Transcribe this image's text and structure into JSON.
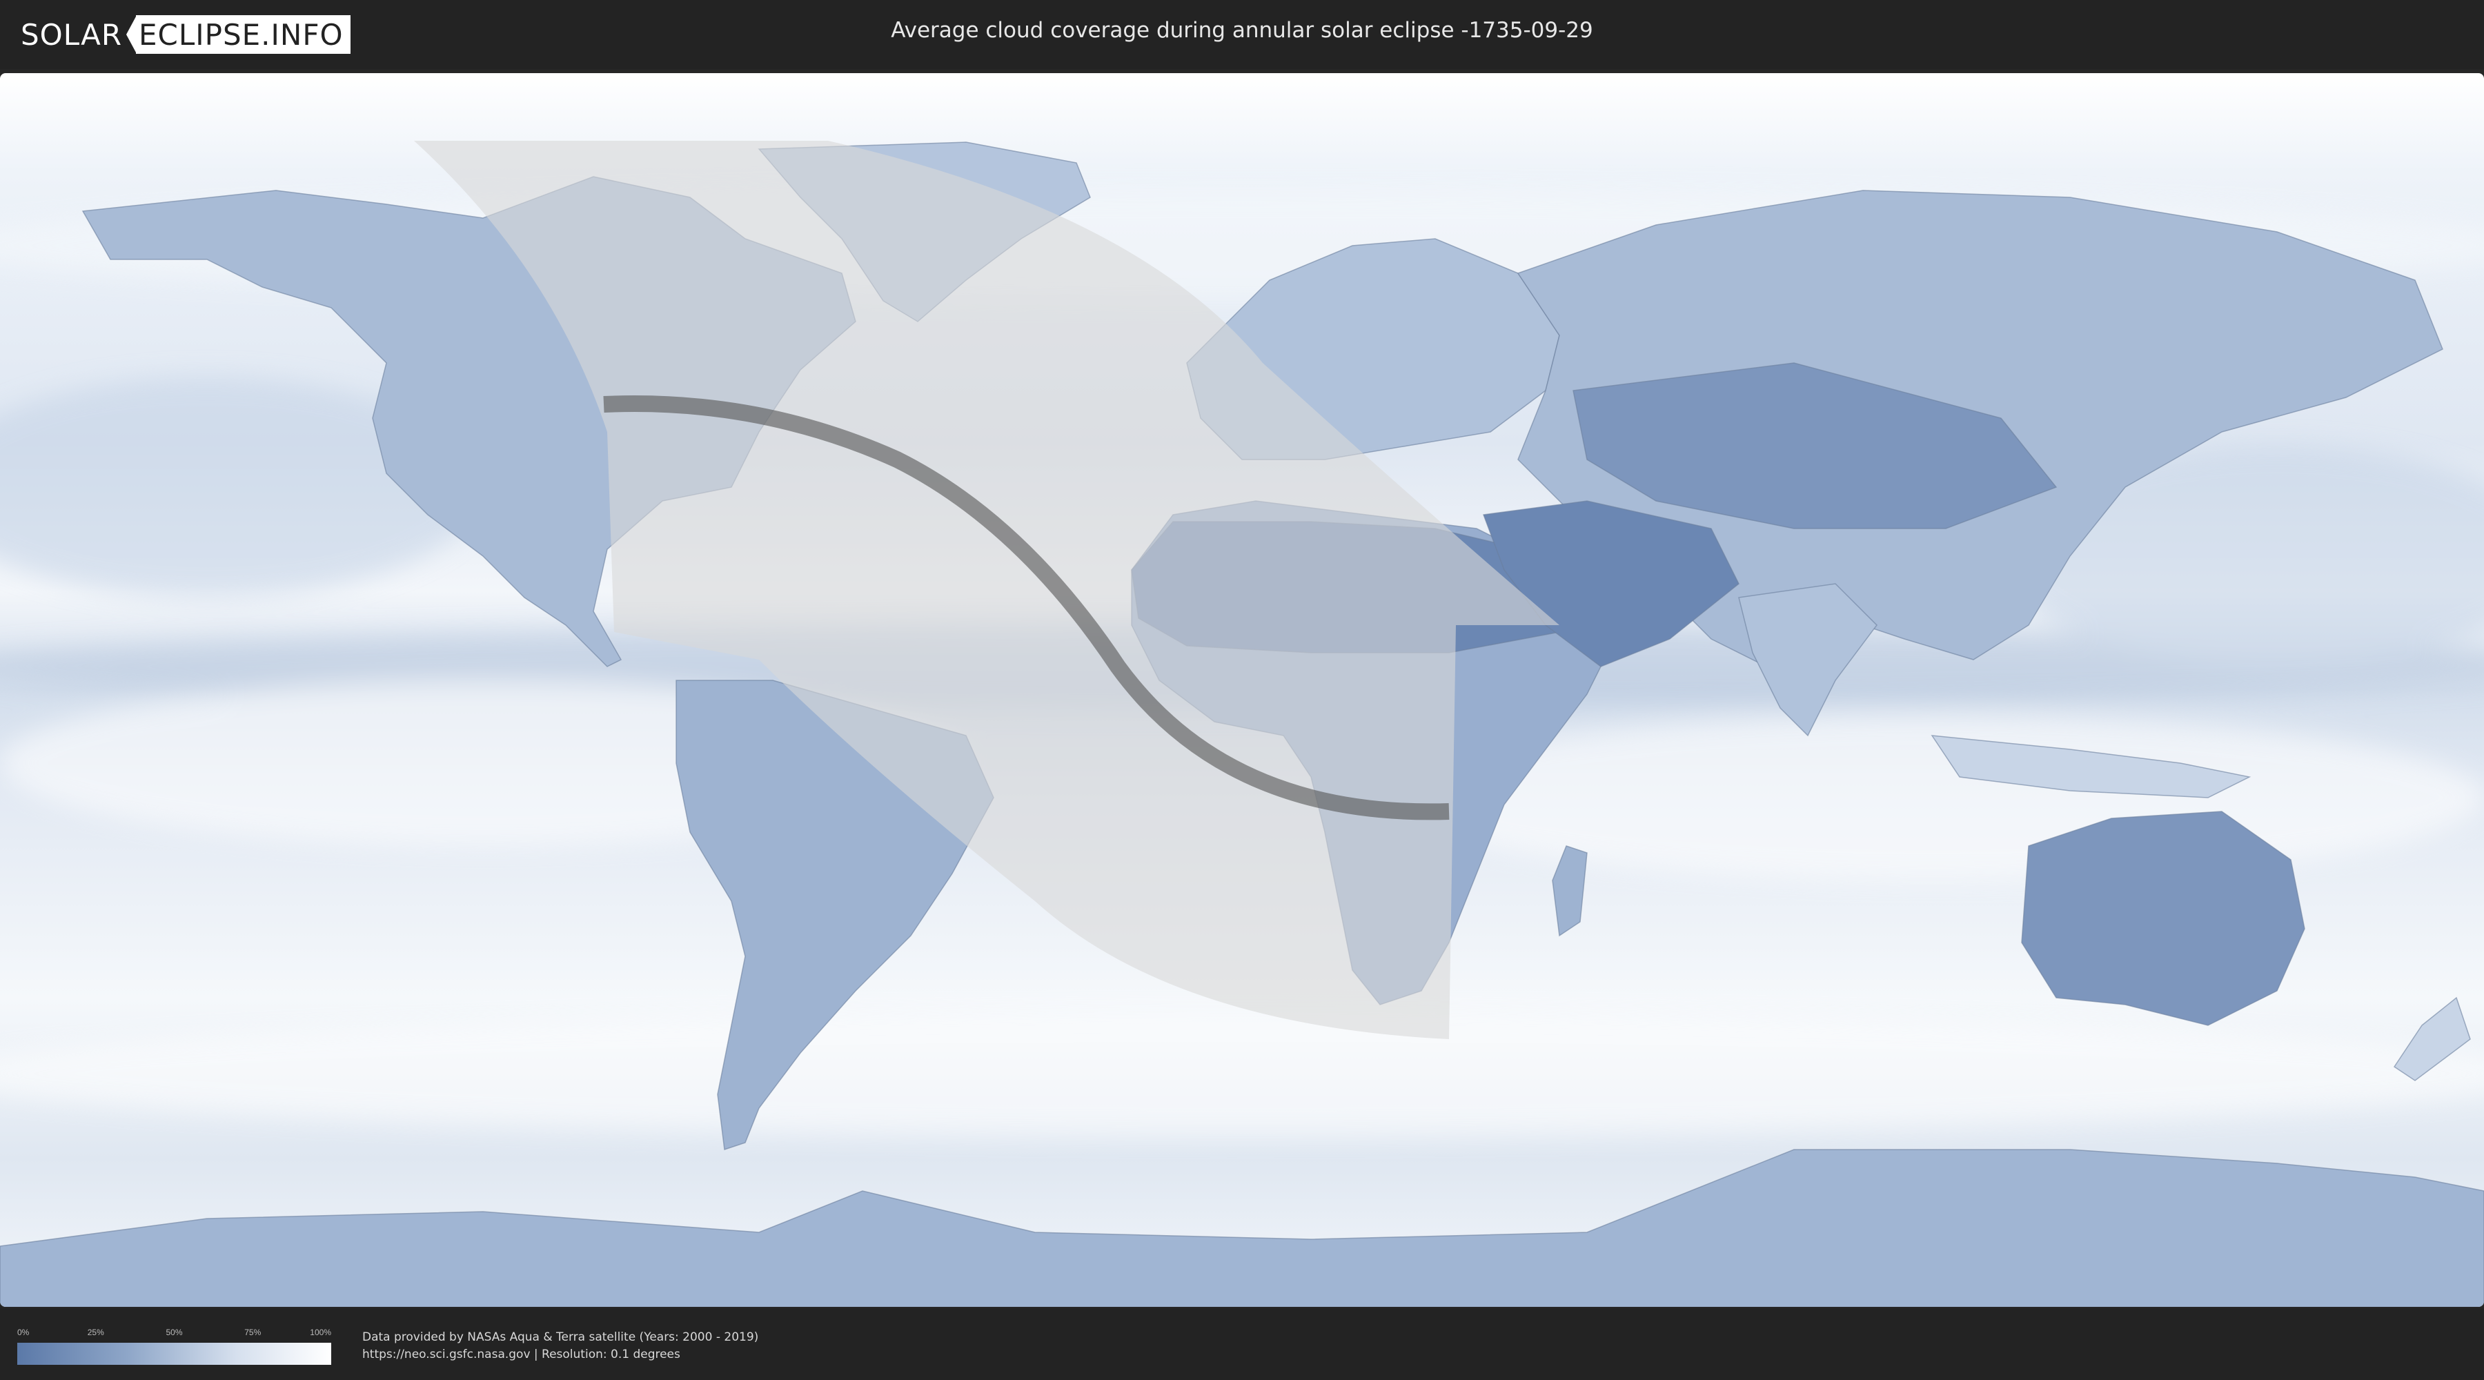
{
  "header": {
    "logo_left": "SOLAR",
    "logo_right": "ECLIPSE.INFO",
    "title": "Average cloud coverage during annular solar eclipse -1735-09-29"
  },
  "map": {
    "projection": "equirectangular",
    "colors": {
      "ocean_cloud": "#e8eef6",
      "clear_sky": "#5b79a8",
      "overcast": "#ffffff",
      "eclipse_zone": "#d9d9d9",
      "central_path": "#555555"
    }
  },
  "legend": {
    "ticks": [
      "0%",
      "25%",
      "50%",
      "75%",
      "100%"
    ],
    "gradient_from": "#5b79a8",
    "gradient_to": "#ffffff"
  },
  "footer": {
    "line1": "Data provided by NASAs Aqua & Terra satellite (Years: 2000 - 2019)",
    "line2": "https://neo.sci.gsfc.nasa.gov | Resolution: 0.1 degrees"
  }
}
